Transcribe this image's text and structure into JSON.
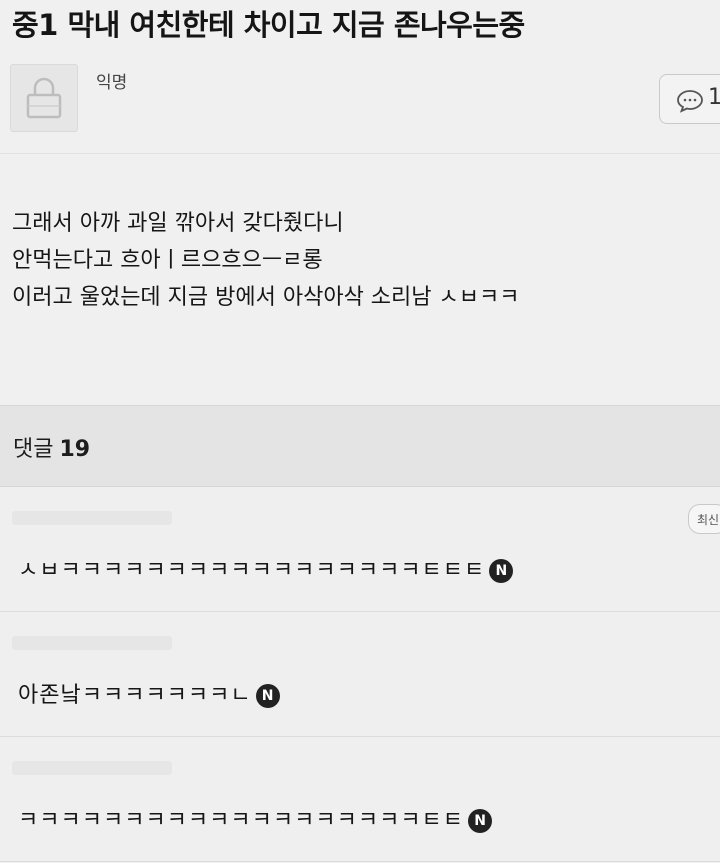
{
  "post": {
    "title": "중1 막내 여친한테 차이고 지금 존나우는중",
    "author": "익명",
    "comment_count_button": "1",
    "body_lines": [
      "그래서 아까 과일 깎아서 갖다줬다니",
      "안먹는다고 흐아ㅣ르으흐으ㅡㄹ롱",
      "이러고 울었는데 지금 방에서 아삭아삭 소리남 ㅅㅂㅋㅋ"
    ]
  },
  "comments_section": {
    "label": "댓글",
    "count": "19",
    "sort_chip": "최신"
  },
  "comments": [
    {
      "text": "ㅅㅂㅋㅋㅋㅋㅋㅋㅋㅋㅋㅋㅋㅋㅋㅋㅋㅋㅋㅌㅌㅌ",
      "badge": "N"
    },
    {
      "text": "아존낰ㅋㅋㅋㅋㅋㅋㅋㄴ",
      "badge": "N"
    },
    {
      "text": "ㅋㅋㅋㅋㅋㅋㅋㅋㅋㅋㅋㅋㅋㅋㅋㅋㅋㅋㅋㅌㅌ",
      "badge": "N"
    }
  ],
  "icons": {
    "avatar": "lock-icon",
    "comment": "speech-bubble-icon"
  }
}
